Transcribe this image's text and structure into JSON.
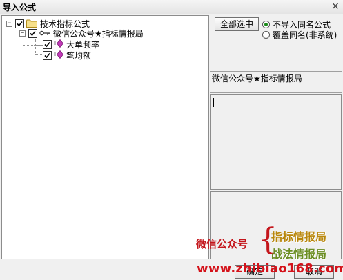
{
  "window": {
    "title": "导入公式",
    "close_label": "×"
  },
  "tree": {
    "root": {
      "label": "技术指标公式",
      "expander": "−",
      "checked": true
    },
    "group": {
      "label": "微信公众号★指标情报局",
      "expander": "−",
      "checked": true
    },
    "items": [
      {
        "label": "大单频率",
        "checked": true
      },
      {
        "label": "笔均额",
        "checked": true
      }
    ]
  },
  "controls": {
    "select_all_label": "全部选中",
    "radio_options": [
      {
        "label": "不导入同名公式",
        "selected": true
      },
      {
        "label": "覆盖同名(非系统)",
        "selected": false
      }
    ]
  },
  "detail": {
    "formula_name": "微信公众号★指标情报局",
    "description": ""
  },
  "actions": {
    "confirm_label": "确定",
    "cancel_label": "取消"
  },
  "watermark": {
    "wechat_label": "微信公众号",
    "brace": "{",
    "line1": "指标情报局",
    "line2": "战法情报局",
    "url": "www.zhibiao168.com"
  },
  "colors": {
    "radio_selected": "#1a8a1a",
    "watermark_red": "#c4161c",
    "watermark_gold": "#b8860b",
    "watermark_green": "#6b8e23"
  }
}
